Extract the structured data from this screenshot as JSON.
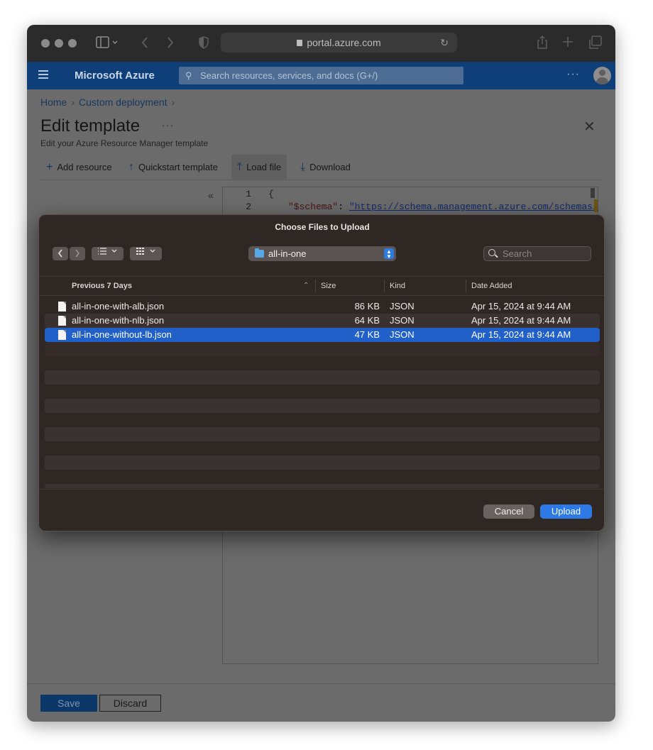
{
  "browser": {
    "address": "portal.azure.com"
  },
  "azure": {
    "brand": "Microsoft Azure",
    "search_placeholder": "Search resources, services, and docs (G+/)",
    "more": "···"
  },
  "page": {
    "breadcrumb": [
      "Home",
      "Custom deployment"
    ],
    "title": "Edit template",
    "title_more": "···",
    "subtitle": "Edit your Azure Resource Manager template",
    "close": "✕",
    "commands": {
      "add_resource": "Add resource",
      "quickstart": "Quickstart template",
      "load_file": "Load file",
      "download": "Download"
    },
    "collapse": "«",
    "editor": {
      "line_numbers": [
        "1",
        "2"
      ],
      "line1": "{",
      "line2_key": "\"$schema\"",
      "line2_sep": ": ",
      "line2_value": "\"https://schema.management.azure.com/schemas/"
    },
    "footer": {
      "save": "Save",
      "discard": "Discard"
    }
  },
  "dialog": {
    "title": "Choose Files to Upload",
    "location": "all-in-one",
    "search_placeholder": "Search",
    "columns": {
      "name": "Previous 7 Days",
      "size": "Size",
      "kind": "Kind",
      "date": "Date Added"
    },
    "files": [
      {
        "name": "all-in-one-with-alb.json",
        "size": "86 KB",
        "kind": "JSON",
        "date": "Apr 15, 2024 at 9:44 AM",
        "selected": false
      },
      {
        "name": "all-in-one-with-nlb.json",
        "size": "64 KB",
        "kind": "JSON",
        "date": "Apr 15, 2024 at 9:44 AM",
        "selected": false
      },
      {
        "name": "all-in-one-without-lb.json",
        "size": "47 KB",
        "kind": "JSON",
        "date": "Apr 15, 2024 at 9:44 AM",
        "selected": true
      }
    ],
    "cancel": "Cancel",
    "upload": "Upload"
  },
  "colors": {
    "azure_header": "#0f3f78",
    "selection": "#2160c8",
    "primary_button": "#2d7ae6"
  }
}
